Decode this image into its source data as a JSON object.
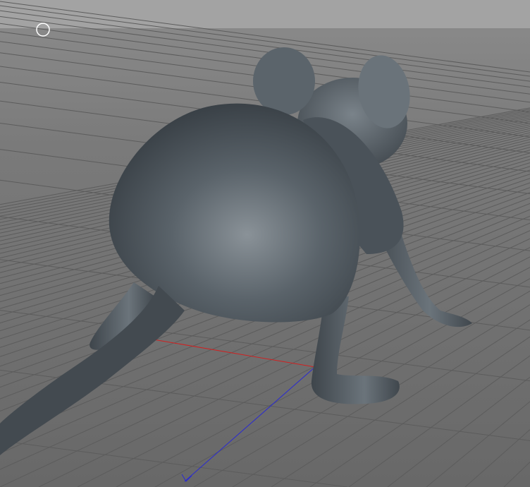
{
  "viewport": {
    "background_color": "#747474",
    "horizon_color": "#a3a3a3",
    "grid_color": "#5c5c5c",
    "model_color": "#4d555c",
    "axis_x_color": "#d02020",
    "axis_z_color": "#2a2ad0"
  }
}
